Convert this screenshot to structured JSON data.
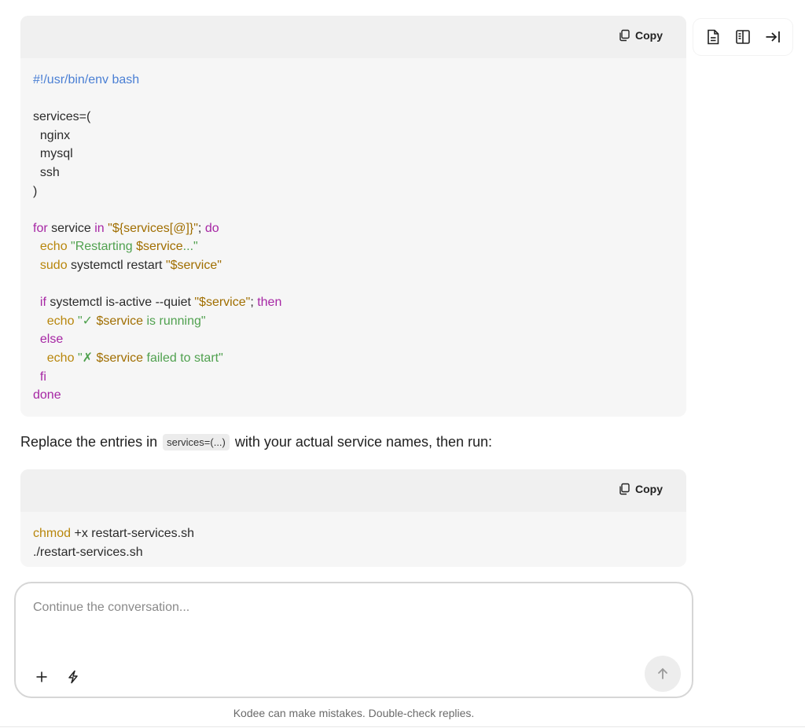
{
  "code_block_1": {
    "copy_label": "Copy",
    "lines": [
      [
        {
          "t": "#!/usr/bin/env bash",
          "c": "shebang"
        }
      ],
      [],
      [
        {
          "t": "services=(",
          "c": "def"
        }
      ],
      [
        {
          "t": "  nginx",
          "c": "def"
        }
      ],
      [
        {
          "t": "  mysql",
          "c": "def"
        }
      ],
      [
        {
          "t": "  ssh",
          "c": "def"
        }
      ],
      [
        {
          "t": ")",
          "c": "def"
        }
      ],
      [],
      [
        {
          "t": "for",
          "c": "kw"
        },
        {
          "t": " service ",
          "c": "def"
        },
        {
          "t": "in",
          "c": "kw"
        },
        {
          "t": " ",
          "c": "def"
        },
        {
          "t": "\"${services[@]}\"",
          "c": "var"
        },
        {
          "t": "; ",
          "c": "def"
        },
        {
          "t": "do",
          "c": "kw"
        }
      ],
      [
        {
          "t": "  ",
          "c": "def"
        },
        {
          "t": "echo",
          "c": "cmd"
        },
        {
          "t": " ",
          "c": "def"
        },
        {
          "t": "\"Restarting ",
          "c": "str"
        },
        {
          "t": "$service",
          "c": "var"
        },
        {
          "t": "...\"",
          "c": "str"
        }
      ],
      [
        {
          "t": "  ",
          "c": "def"
        },
        {
          "t": "sudo",
          "c": "cmd"
        },
        {
          "t": " systemctl restart ",
          "c": "def"
        },
        {
          "t": "\"$service\"",
          "c": "var"
        }
      ],
      [],
      [
        {
          "t": "  ",
          "c": "def"
        },
        {
          "t": "if",
          "c": "kw"
        },
        {
          "t": " systemctl is-active --quiet ",
          "c": "def"
        },
        {
          "t": "\"$service\"",
          "c": "var"
        },
        {
          "t": "; ",
          "c": "def"
        },
        {
          "t": "then",
          "c": "kw"
        }
      ],
      [
        {
          "t": "    ",
          "c": "def"
        },
        {
          "t": "echo",
          "c": "cmd"
        },
        {
          "t": " ",
          "c": "def"
        },
        {
          "t": "\"✓ ",
          "c": "str"
        },
        {
          "t": "$service",
          "c": "var"
        },
        {
          "t": " is running\"",
          "c": "str"
        }
      ],
      [
        {
          "t": "  ",
          "c": "def"
        },
        {
          "t": "else",
          "c": "kw"
        }
      ],
      [
        {
          "t": "    ",
          "c": "def"
        },
        {
          "t": "echo",
          "c": "cmd"
        },
        {
          "t": " ",
          "c": "def"
        },
        {
          "t": "\"✗ ",
          "c": "str"
        },
        {
          "t": "$service",
          "c": "var"
        },
        {
          "t": " failed to start\"",
          "c": "str"
        }
      ],
      [
        {
          "t": "  ",
          "c": "def"
        },
        {
          "t": "fi",
          "c": "kw"
        }
      ],
      [
        {
          "t": "done",
          "c": "kw"
        }
      ]
    ]
  },
  "prose": {
    "before": "Replace the entries in",
    "inline_code": "services=(...)",
    "after": "with your actual service names, then run:"
  },
  "code_block_2": {
    "copy_label": "Copy",
    "lines": [
      [
        {
          "t": "chmod",
          "c": "cmd"
        },
        {
          "t": " +x restart-services.sh",
          "c": "def"
        }
      ],
      [
        {
          "t": "./restart-services.sh",
          "c": "def"
        }
      ]
    ]
  },
  "toolbar": {
    "icons": [
      "document-icon",
      "split-view-icon",
      "collapse-panel-icon"
    ]
  },
  "composer": {
    "placeholder": "Continue the conversation...",
    "value": ""
  },
  "disclaimer": "Kodee can make mistakes. Double-check replies.",
  "colors": {
    "shebang": "#4a7fd4",
    "keyword": "#a626a4",
    "command": "#b8860b",
    "string": "#50a14f",
    "variable": "#a06e00",
    "code_bg": "#f6f6f6",
    "code_bar_bg": "#f0f0f0"
  }
}
